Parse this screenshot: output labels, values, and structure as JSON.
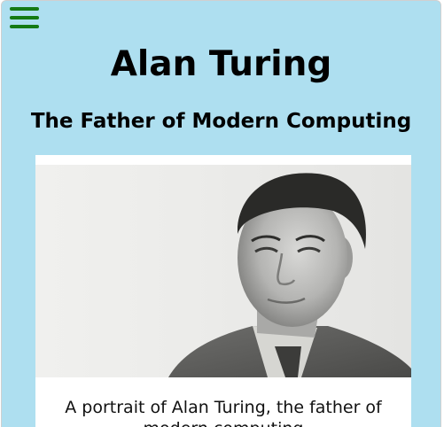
{
  "header": {
    "menu_icon": "hamburger-menu-icon",
    "title": "Alan Turing",
    "subtitle": "The Father of Modern Computing"
  },
  "figure": {
    "image_subject": "black-and-white portrait photograph",
    "caption": "A portrait of Alan Turing, the father of modern computing"
  },
  "colors": {
    "page_background": "#aedff0",
    "menu_icon": "#147a14",
    "card_background": "#ffffff"
  }
}
